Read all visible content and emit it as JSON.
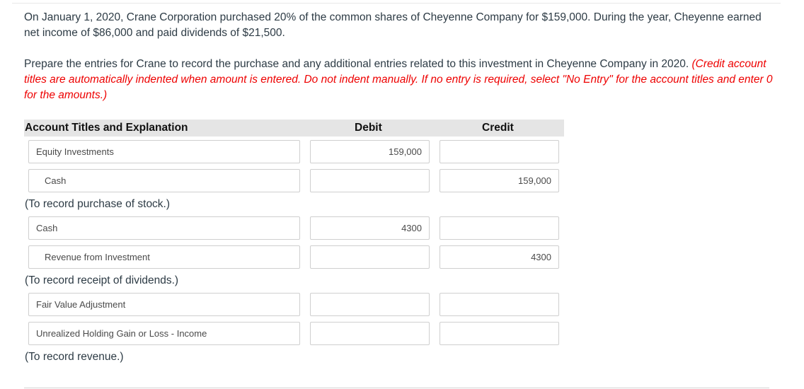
{
  "question": {
    "paragraph1": "On January 1, 2020, Crane Corporation purchased 20% of the common shares of Cheyenne Company for $159,000. During the year, Cheyenne earned net income of $86,000 and paid dividends of $21,500.",
    "paragraph2_text": "Prepare the entries for Crane to record the purchase and any additional entries related to this investment in Cheyenne Company in 2020. ",
    "paragraph2_instruction": "(Credit account titles are automatically indented when amount is entered. Do not indent manually. If no entry is required, select \"No Entry\" for the account titles and enter 0 for the amounts.)"
  },
  "table": {
    "headers": {
      "account": "Account Titles and Explanation",
      "debit": "Debit",
      "credit": "Credit"
    },
    "entries": [
      {
        "rows": [
          {
            "account": "Equity Investments",
            "debit": "159,000",
            "credit": ""
          },
          {
            "account": "Cash",
            "debit": "",
            "credit": "159,000"
          }
        ],
        "explanation": "(To record purchase of stock.)"
      },
      {
        "rows": [
          {
            "account": "Cash",
            "debit": "4300",
            "credit": ""
          },
          {
            "account": "Revenue from Investment",
            "debit": "",
            "credit": "4300"
          }
        ],
        "explanation": "(To record receipt of dividends.)"
      },
      {
        "rows": [
          {
            "account": "Fair Value Adjustment",
            "debit": "",
            "credit": ""
          },
          {
            "account": "Unrealized Holding Gain or Loss - Income",
            "debit": "",
            "credit": ""
          }
        ],
        "explanation": "(To record revenue.)"
      }
    ]
  }
}
